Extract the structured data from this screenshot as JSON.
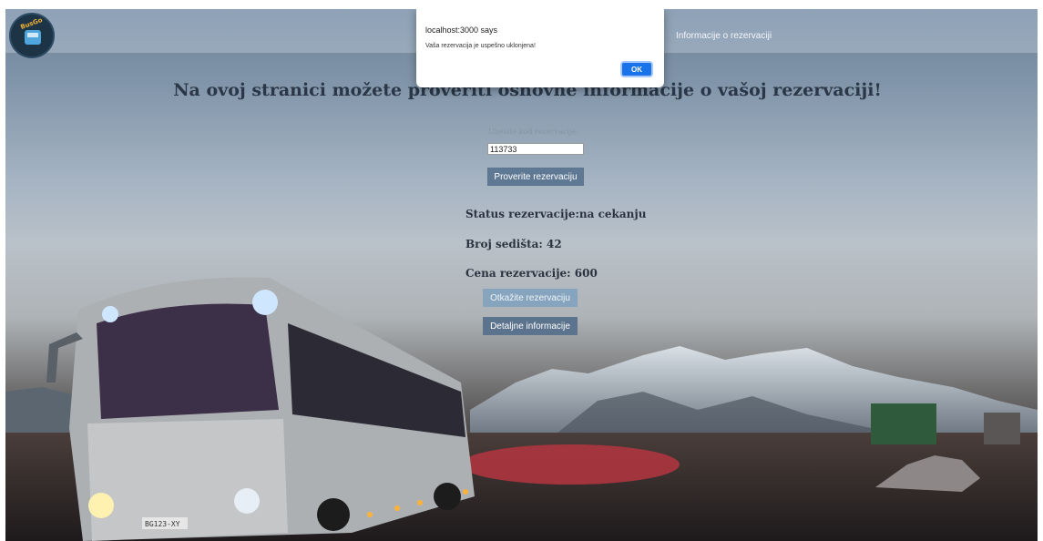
{
  "navbar": {
    "logo_text": "BusGo",
    "link": "Informacije o rezervaciji"
  },
  "main": {
    "headline": "Na ovoj stranici možete proveriti osnovne informacije o vašoj rezervaciji!",
    "code_label": "Unesite kod rezervacije:",
    "code_value": "113733",
    "check_button": "Proverite rezervaciju",
    "status": "Status rezervacije:na cekanju",
    "seats": "Broj sedišta: 42",
    "price": "Cena rezervacije: 600",
    "cancel_button": "Otkažite rezervaciju",
    "details_button": "Detaljne informacije"
  },
  "alert": {
    "title": "localhost:3000 says",
    "message": "Vaša rezervacija je uspešno uklonjena!",
    "ok_label": "OK"
  },
  "bus_plate": "BG123-XY",
  "colors": {
    "accent_button": "#5f7994",
    "dialog_ok": "#1a73e8",
    "headline": "#2b3746"
  }
}
